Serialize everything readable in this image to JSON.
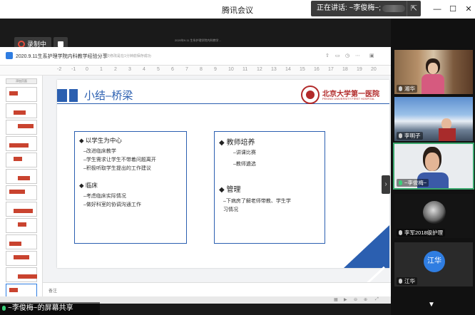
{
  "window": {
    "title": "腾讯会议",
    "speaking": "正在讲话: ~李俊梅~;",
    "pin_icon": "pin-icon",
    "minimize": "—",
    "restore": "☐",
    "close": "✕"
  },
  "recording": {
    "label": "录制中",
    "stop_icon": "stop-icon"
  },
  "document": {
    "title": "2020.9.11生系护理学院内科教学经验分享",
    "saved_note": "上次修改是在1分钟前保存成功",
    "tiny_top": "2020年9.11 生系护理学院内科教学...",
    "ruler_marks": [
      "-2",
      "-1",
      "0",
      "1",
      "2",
      "3",
      "4",
      "5",
      "6",
      "7",
      "8",
      "9",
      "10",
      "11",
      "12",
      "13",
      "14",
      "15",
      "16",
      "17",
      "18",
      "19",
      "20"
    ],
    "sidebar_button": "添加页面",
    "notes_placeholder": "备注"
  },
  "slide": {
    "title": "小结–桥梁",
    "logo": "北京大学第一医院",
    "logo_sub": "PEKING UNIVERSITY FIRST HOSPITAL",
    "left": {
      "h1": "◆ 以学生为中心",
      "items1": [
        "–改进临床教学",
        "–学生需求让学生不带着问题离开",
        "–积极听取学生提出的工作建议"
      ],
      "h2": "◆ 临床",
      "items2": [
        "–考虑临床实际情况",
        "–做好科室的协调沟通工作"
      ]
    },
    "right": {
      "h1": "◆ 教师培养",
      "items1": [
        "–讲课比赛",
        "–教师遴选"
      ],
      "h2": "◆ 管理",
      "items2": [
        "–下病房了解老师带教、学生学",
        "习情况"
      ]
    }
  },
  "share_label": "~李俊梅~的屏幕共享",
  "participants": [
    {
      "name": "湘华",
      "mic": "mic-icon"
    },
    {
      "name": "李明子",
      "mic": "mic-icon"
    },
    {
      "name": "~李俊梅~",
      "mic": "mic-icon"
    },
    {
      "name": "李军2018级护理",
      "mic": "mic-icon"
    },
    {
      "name": "江华",
      "avatar": "江华",
      "mic": "mic-icon"
    }
  ],
  "more_icon": "▼"
}
